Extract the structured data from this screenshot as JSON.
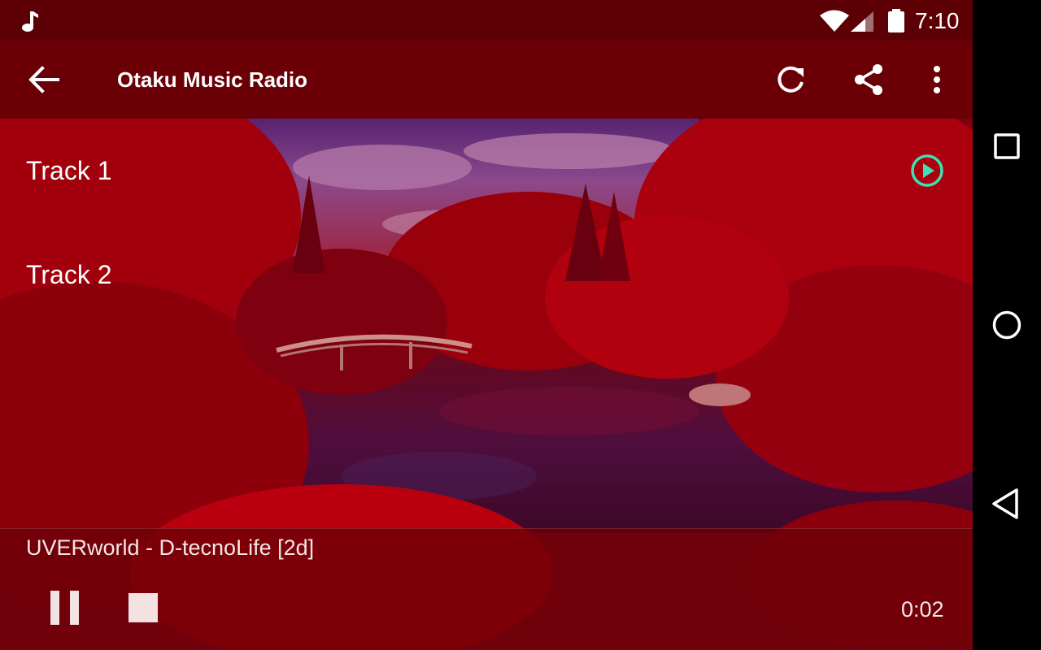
{
  "status_bar": {
    "time": "7:10",
    "icons": [
      "music-note-icon",
      "wifi-icon",
      "cell-signal-icon",
      "battery-icon"
    ]
  },
  "toolbar": {
    "title": "Otaku Music Radio",
    "icons": [
      "back-arrow-icon",
      "refresh-icon",
      "share-icon",
      "more-vert-icon"
    ]
  },
  "tracks": [
    {
      "label": "Track 1",
      "playing": true,
      "icon": "play-circle-icon"
    },
    {
      "label": "Track 2",
      "playing": false
    }
  ],
  "player": {
    "now_playing": "UVERworld - D-tecnoLife [2d]",
    "elapsed": "0:02",
    "controls": [
      "pause-icon",
      "stop-icon"
    ]
  },
  "navigation_bar": {
    "buttons": [
      "recents-icon",
      "home-icon",
      "back-icon"
    ]
  },
  "colors": {
    "primary": "#6a0006",
    "status_bar": "#5c0005",
    "accent": "#3fe0b5"
  }
}
